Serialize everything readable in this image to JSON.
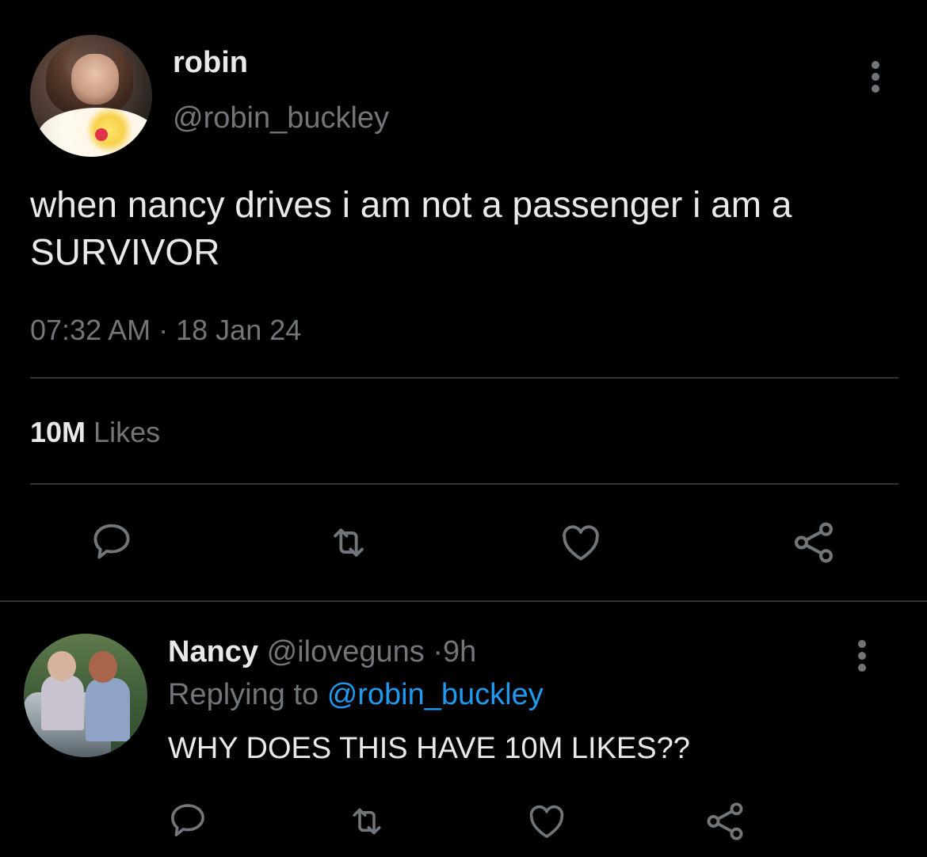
{
  "tweet": {
    "author_name": "robin",
    "author_handle": "@robin_buckley",
    "text": "when nancy drives i am not a passenger i am a SURVIVOR",
    "time": "07:32 AM",
    "separator": "·",
    "date": "18 Jan 24",
    "likes_count": "10M",
    "likes_label": "Likes",
    "more_icon": "more-vertical-icon",
    "actions": [
      "reply-icon",
      "retweet-icon",
      "like-icon",
      "share-icon"
    ]
  },
  "reply": {
    "author_name": "Nancy",
    "author_handle": "@iloveguns",
    "separator": "·",
    "age": "9h",
    "replying_prefix": "Replying to",
    "replying_handle": "@robin_buckley",
    "text": "WHY DOES THIS HAVE 10M LIKES??",
    "more_icon": "more-vertical-icon",
    "actions": [
      "reply-icon",
      "retweet-icon",
      "like-icon",
      "share-icon"
    ]
  },
  "colors": {
    "background": "#000000",
    "primary_text": "#e7e9ea",
    "secondary_text": "#71767b",
    "link": "#1d9bf0",
    "divider": "#2f3336"
  }
}
